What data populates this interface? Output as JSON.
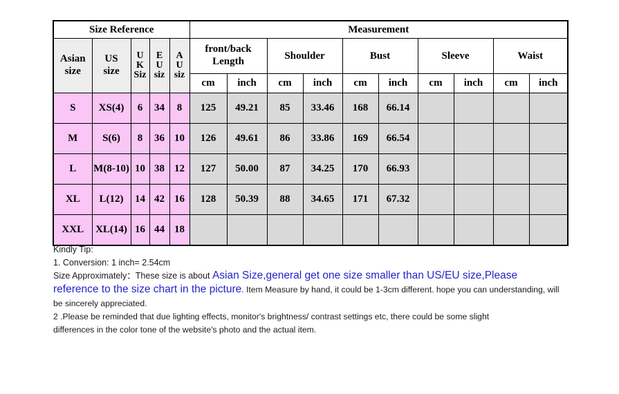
{
  "table": {
    "group_headers": [
      {
        "label": "Size Reference",
        "span": 5
      },
      {
        "label": "Measurement",
        "span": 8
      }
    ],
    "sub_headers": [
      {
        "label": "Asian size",
        "lines": [
          "Asian",
          "size"
        ]
      },
      {
        "label": "US size",
        "lines": [
          "US",
          "size"
        ]
      },
      {
        "label": "UK Siz",
        "lines": [
          "U",
          "K",
          "Siz"
        ]
      },
      {
        "label": "EU siz",
        "lines": [
          "E",
          "U",
          "siz"
        ]
      },
      {
        "label": "AU siz",
        "lines": [
          "A",
          "U",
          "siz"
        ]
      },
      {
        "label": "front/back Length",
        "lines": [
          "front/back",
          "Length"
        ],
        "span": 2
      },
      {
        "label": "Shoulder",
        "lines": [
          "Shoulder"
        ],
        "span": 2
      },
      {
        "label": "Bust",
        "lines": [
          "Bust"
        ],
        "span": 2
      },
      {
        "label": "Sleeve",
        "lines": [
          "Sleeve"
        ],
        "span": 2
      },
      {
        "label": "Waist",
        "lines": [
          "Waist"
        ],
        "span": 2
      }
    ],
    "unit_headers": [
      "cm",
      "inch",
      "cm",
      "inch",
      "cm",
      "inch",
      "cm",
      "inch",
      "cm",
      "inch"
    ],
    "rows": [
      {
        "asian_size": "S",
        "us_size": "XS(4)",
        "uk_size": "6",
        "eu_size": "34",
        "au_size": "8",
        "length_cm": "125",
        "length_inch": "49.21",
        "shoulder_cm": "85",
        "shoulder_inch": "33.46",
        "bust_cm": "168",
        "bust_inch": "66.14",
        "sleeve_cm": "",
        "sleeve_inch": "",
        "waist_cm": "",
        "waist_inch": ""
      },
      {
        "asian_size": "M",
        "us_size": "S(6)",
        "uk_size": "8",
        "eu_size": "36",
        "au_size": "10",
        "length_cm": "126",
        "length_inch": "49.61",
        "shoulder_cm": "86",
        "shoulder_inch": "33.86",
        "bust_cm": "169",
        "bust_inch": "66.54",
        "sleeve_cm": "",
        "sleeve_inch": "",
        "waist_cm": "",
        "waist_inch": ""
      },
      {
        "asian_size": "L",
        "us_size": "M(8-10)",
        "uk_size": "10",
        "eu_size": "38",
        "au_size": "12",
        "length_cm": "127",
        "length_inch": "50.00",
        "shoulder_cm": "87",
        "shoulder_inch": "34.25",
        "bust_cm": "170",
        "bust_inch": "66.93",
        "sleeve_cm": "",
        "sleeve_inch": "",
        "waist_cm": "",
        "waist_inch": ""
      },
      {
        "asian_size": "XL",
        "us_size": "L(12)",
        "uk_size": "14",
        "eu_size": "42",
        "au_size": "16",
        "length_cm": "128",
        "length_inch": "50.39",
        "shoulder_cm": "88",
        "shoulder_inch": "34.65",
        "bust_cm": "171",
        "bust_inch": "67.32",
        "sleeve_cm": "",
        "sleeve_inch": "",
        "waist_cm": "",
        "waist_inch": ""
      },
      {
        "asian_size": "XXL",
        "us_size": "XL(14)",
        "uk_size": "16",
        "eu_size": "44",
        "au_size": "18",
        "length_cm": "",
        "length_inch": "",
        "shoulder_cm": "",
        "shoulder_inch": "",
        "bust_cm": "",
        "bust_inch": "",
        "sleeve_cm": "",
        "sleeve_inch": "",
        "waist_cm": "",
        "waist_inch": ""
      }
    ]
  },
  "notes": {
    "title": "Kindly Tip:",
    "conversion": "1. Conversion:  1 inch= 2.54cm",
    "approx_prefix": "Size Approximately：These size is about ",
    "approx_blue_1": "Asian Size,general get one size smaller than US/EU size,Please",
    "approx_blue_2": "reference to the size chart in the picture",
    "approx_suffix": ". Item Measure by hand, it could be 1-3cm different. hope you can",
    "approx_tail": "understanding, will be sincerely appreciated.",
    "item2_line1": "2 .Please be reminded that due lighting effects, monitor's brightness/ contrast settings etc, there could be some slight",
    "item2_line2": "differences in the color tone of the website's photo and the actual item."
  },
  "colors": {
    "pink": "#f9c6f5",
    "gray": "#d9d9d9",
    "header_gray": "#ededed",
    "blue_text": "#2424c8",
    "border": "#000000"
  }
}
